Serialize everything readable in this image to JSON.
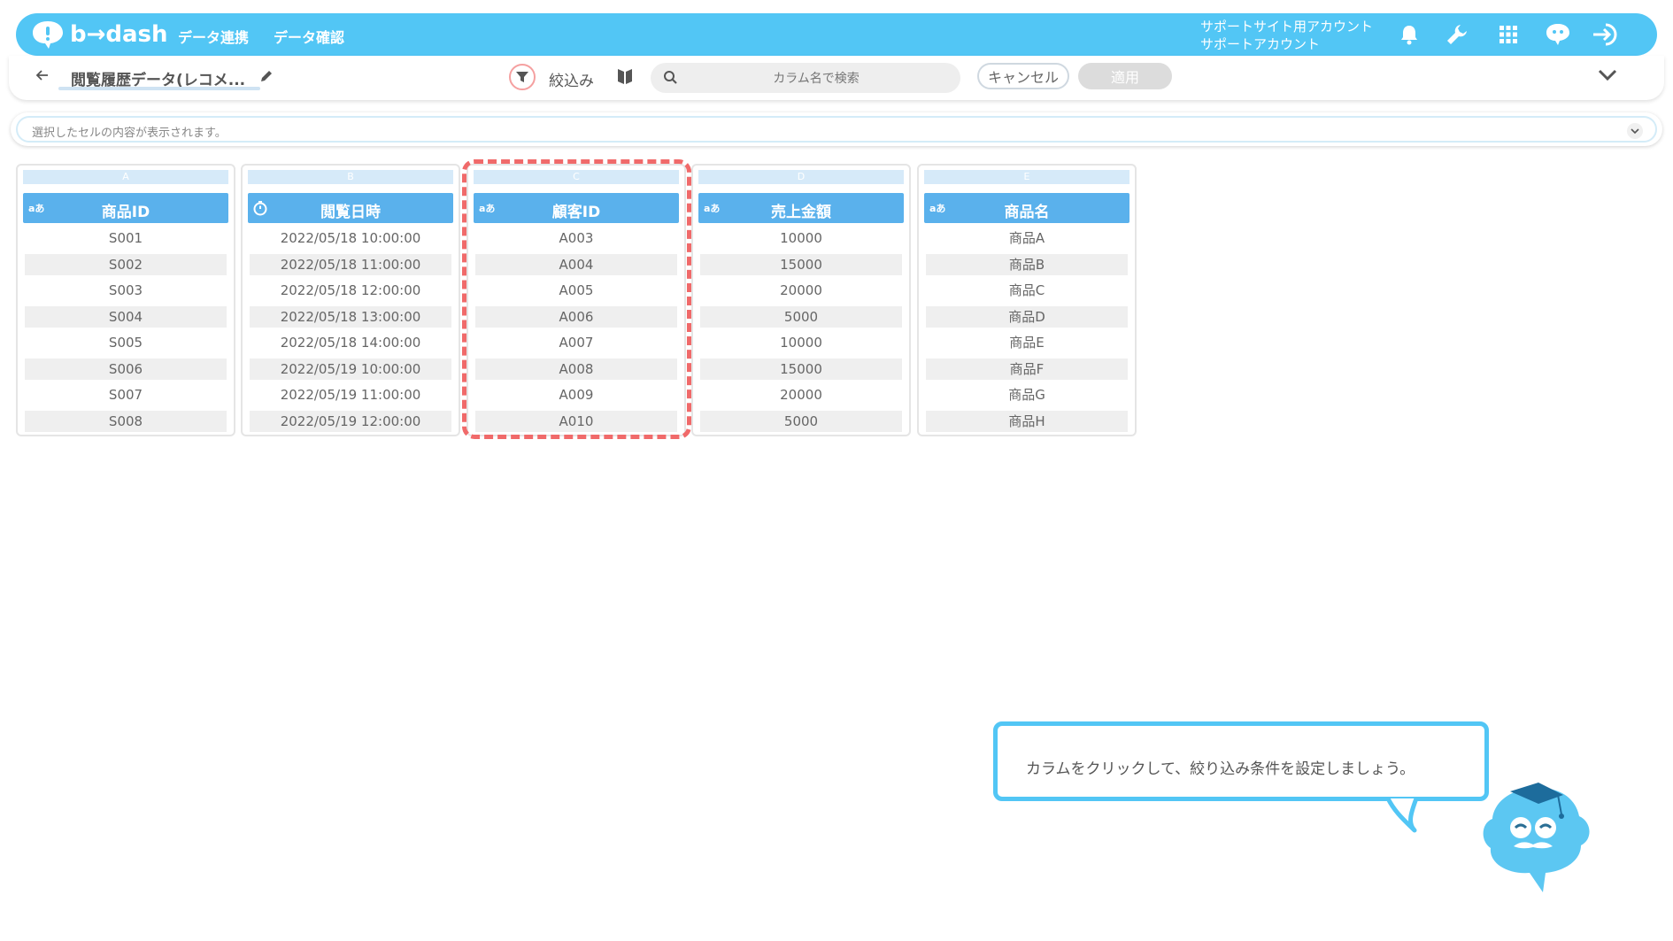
{
  "header": {
    "logo_text": "b→dash",
    "nav": [
      "データ連携",
      "データ確認"
    ],
    "account_line1": "サポートサイト用アカウント",
    "account_line2": "サポートアカウント",
    "icons": [
      "bell-icon",
      "wrench-icon",
      "grid-icon",
      "chat-icon",
      "logout-icon"
    ]
  },
  "toolbar": {
    "dataset_name": "閲覧履歴データ(レコメ...",
    "filter_label": "絞込み",
    "search_placeholder": "カラム名で検索",
    "cancel_label": "キャンセル",
    "apply_label": "適用"
  },
  "cellbar": {
    "placeholder": "選択したセルの内容が表示されます。"
  },
  "columns": [
    {
      "letter": "A",
      "type": "aあ",
      "name": "商品ID",
      "values": [
        "S001",
        "S002",
        "S003",
        "S004",
        "S005",
        "S006",
        "S007",
        "S008"
      ]
    },
    {
      "letter": "B",
      "type": "clock",
      "name": "閲覧日時",
      "values": [
        "2022/05/18 10:00:00",
        "2022/05/18 11:00:00",
        "2022/05/18 12:00:00",
        "2022/05/18 13:00:00",
        "2022/05/18 14:00:00",
        "2022/05/19 10:00:00",
        "2022/05/19 11:00:00",
        "2022/05/19 12:00:00"
      ]
    },
    {
      "letter": "C",
      "type": "aあ",
      "name": "顧客ID",
      "values": [
        "A003",
        "A004",
        "A005",
        "A006",
        "A007",
        "A008",
        "A009",
        "A010"
      ]
    },
    {
      "letter": "D",
      "type": "aあ",
      "name": "売上金額",
      "values": [
        "10000",
        "15000",
        "20000",
        "5000",
        "10000",
        "15000",
        "20000",
        "5000"
      ]
    },
    {
      "letter": "E",
      "type": "aあ",
      "name": "商品名",
      "values": [
        "商品A",
        "商品B",
        "商品C",
        "商品D",
        "商品E",
        "商品F",
        "商品G",
        "商品H"
      ]
    }
  ],
  "tooltip": {
    "text": "カラムをクリックして、絞り込み条件を設定しましょう。"
  },
  "colors": {
    "header_bg": "#52c6f5",
    "column_header_bg": "#5ab1ec",
    "highlight_dash": "#f06a6a"
  }
}
